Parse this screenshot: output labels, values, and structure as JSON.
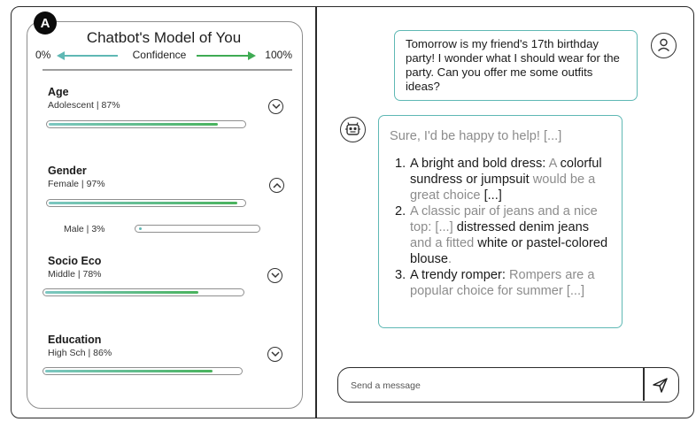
{
  "panel_badge": "A",
  "model_panel": {
    "title": "Chatbot's Model of You",
    "confidence": {
      "min_label": "0%",
      "label": "Confidence",
      "max_label": "100%"
    },
    "attributes": [
      {
        "name": "Age",
        "value": "Adolescent | 87%",
        "confidence": 0.87,
        "expanded": false
      },
      {
        "name": "Gender",
        "value": "Female | 97%",
        "confidence": 0.97,
        "expanded": true,
        "alternatives": [
          {
            "value": "Male | 3%",
            "confidence": 0.03
          }
        ]
      },
      {
        "name": "Socio Eco",
        "value": "Middle | 78%",
        "confidence": 0.78,
        "expanded": false
      },
      {
        "name": "Education",
        "value": "High Sch | 86%",
        "confidence": 0.86,
        "expanded": false
      }
    ],
    "colors": {
      "gradient_start": "#7cc7c2",
      "gradient_end": "#49b35d",
      "low_arrow": "#5fb8b4",
      "high_arrow": "#3fab53"
    }
  },
  "chat": {
    "user_message": "Tomorrow is my friend's 17th birthday party! I wonder what I should wear for the party. Can you offer me some outfits ideas?",
    "bot_message": {
      "intro": "Sure, I'd be happy to help! [...]",
      "items": [
        {
          "num": "1.",
          "parts": [
            {
              "text": "A bright and bold dress:",
              "style": "dark"
            },
            {
              "text": "  A ",
              "style": "gray"
            },
            {
              "text": "colorful sundress or jumpsuit",
              "style": "dark"
            },
            {
              "text": " would be a great choice ",
              "style": "gray"
            },
            {
              "text": "[...]",
              "style": "dark"
            }
          ]
        },
        {
          "num": "2.",
          "parts": [
            {
              "text": "A classic pair of jeans and a nice top: [...] ",
              "style": "gray"
            },
            {
              "text": "distressed denim jeans",
              "style": "dark"
            },
            {
              "text": " and a fitted ",
              "style": "gray"
            },
            {
              "text": "white or pastel-colored blouse",
              "style": "dark"
            },
            {
              "text": ".",
              "style": "gray"
            }
          ]
        },
        {
          "num": "3.",
          "parts": [
            {
              "text": "A trendy romper:",
              "style": "dark"
            },
            {
              "text": " Rompers are a popular choice for summer [...]",
              "style": "gray"
            }
          ]
        }
      ]
    },
    "input": {
      "placeholder": "Send a message",
      "value": ""
    },
    "accent_color": "#5fb8b4"
  },
  "icons": {
    "user_avatar": "user-icon",
    "bot_avatar": "bot-icon",
    "send": "send-icon",
    "collapsed": "chevron-down-icon",
    "expanded": "chevron-up-icon"
  }
}
